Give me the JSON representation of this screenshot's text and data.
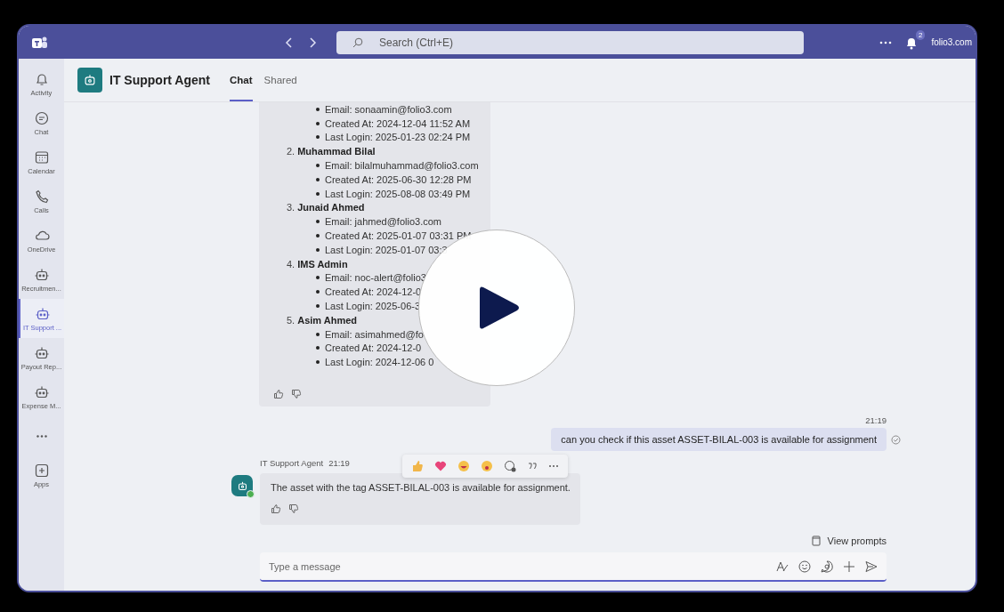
{
  "top_bar": {
    "search_placeholder": "Search (Ctrl+E)",
    "notification_count": "2",
    "organization": "folio3.com"
  },
  "sidebar": {
    "items": [
      {
        "label": "Activity",
        "kind": "bell",
        "selected": false
      },
      {
        "label": "Chat",
        "kind": "chat",
        "selected": false
      },
      {
        "label": "Calendar",
        "kind": "calendar",
        "selected": false
      },
      {
        "label": "Calls",
        "kind": "phone",
        "selected": false
      },
      {
        "label": "OneDrive",
        "kind": "cloud",
        "selected": false
      },
      {
        "label": "Recruitmen...",
        "kind": "bot",
        "selected": false
      },
      {
        "label": "IT Support ...",
        "kind": "bot",
        "selected": true
      },
      {
        "label": "Payout Rep...",
        "kind": "bot",
        "selected": false
      },
      {
        "label": "Expense M...",
        "kind": "bot",
        "selected": false
      },
      {
        "kind": "more",
        "selected": false
      },
      {
        "label": "Apps",
        "kind": "apps",
        "selected": false
      }
    ]
  },
  "header": {
    "title": "IT Support Agent",
    "tabs": [
      {
        "label": "Chat",
        "selected": true
      },
      {
        "label": "Shared",
        "selected": false
      }
    ]
  },
  "messages": [
    {
      "kind": "bot_list",
      "users": [
        {
          "details": [
            "Email: sonaamin@folio3.com",
            "Created At: 2024-12-04 11:52 AM",
            "Last Login: 2025-01-23 02:24 PM"
          ]
        },
        {
          "number": "2.",
          "name": "Muhammad Bilal",
          "details": [
            "Email: bilalmuhammad@folio3.com",
            "Created At: 2025-06-30 12:28 PM",
            "Last Login: 2025-08-08 03:49 PM"
          ]
        },
        {
          "number": "3.",
          "name": "Junaid Ahmed",
          "details": [
            "Email: jahmed@folio3.com",
            "Created At: 2025-01-07 03:31 PM",
            "Last Login: 2025-01-07 03:3"
          ]
        },
        {
          "number": "4.",
          "name": "IMS Admin",
          "details": [
            "Email: noc-alert@folio3",
            "Created At: 2024-12-0",
            "Last Login: 2025-06-3"
          ]
        },
        {
          "number": "5.",
          "name": "Asim Ahmed",
          "details": [
            "Email: asimahmed@fo",
            "Created At: 2024-12-0",
            "Last Login: 2024-12-06 0"
          ]
        }
      ]
    },
    {
      "kind": "sent",
      "time": "21:19",
      "text": "can you check if this asset ASSET-BILAL-003 is available for assignment"
    },
    {
      "kind": "received",
      "sender": "IT Support Agent",
      "time": "21:19",
      "text": "The asset with the tag ASSET-BILAL-003 is available for assignment."
    }
  ],
  "view_prompts": "View prompts",
  "composer": {
    "placeholder": "Type a message"
  },
  "video_overlay": {
    "paused": true
  }
}
